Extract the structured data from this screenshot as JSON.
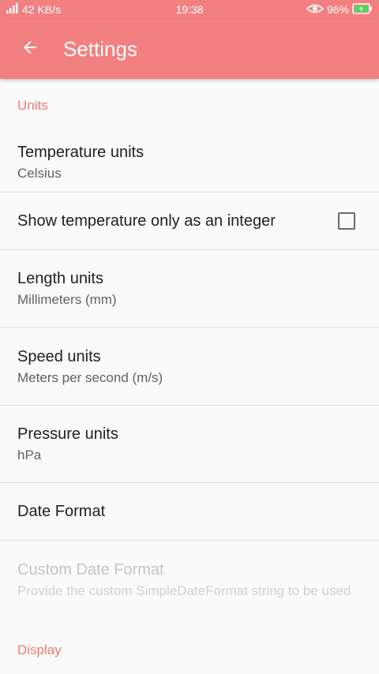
{
  "status_bar": {
    "signal_icon": "signal-icon",
    "network_speed": "42 KB/s",
    "time": "19:38",
    "eye_icon": "eye-icon",
    "battery_percent": "96%",
    "battery_icon": "battery-charging-icon"
  },
  "toolbar": {
    "back_icon": "back-arrow-icon",
    "title": "Settings",
    "background_color": "#f28080"
  },
  "sections": {
    "units": {
      "header": "Units"
    },
    "display": {
      "header": "Display"
    }
  },
  "prefs": {
    "temperature": {
      "title": "Temperature units",
      "summary": "Celsius"
    },
    "integer": {
      "title": "Show temperature only as an integer",
      "checked": false
    },
    "length": {
      "title": "Length units",
      "summary": "Millimeters (mm)"
    },
    "speed": {
      "title": "Speed units",
      "summary": "Meters per second (m/s)"
    },
    "pressure": {
      "title": "Pressure units",
      "summary": "hPa"
    },
    "date_format": {
      "title": "Date Format"
    },
    "custom_date": {
      "title": "Custom Date Format",
      "summary": "Provide the custom SimpleDateFormat string to be used",
      "enabled": false
    }
  },
  "colors": {
    "accent": "#ef7a6f",
    "divider": "#e0e0e0"
  }
}
